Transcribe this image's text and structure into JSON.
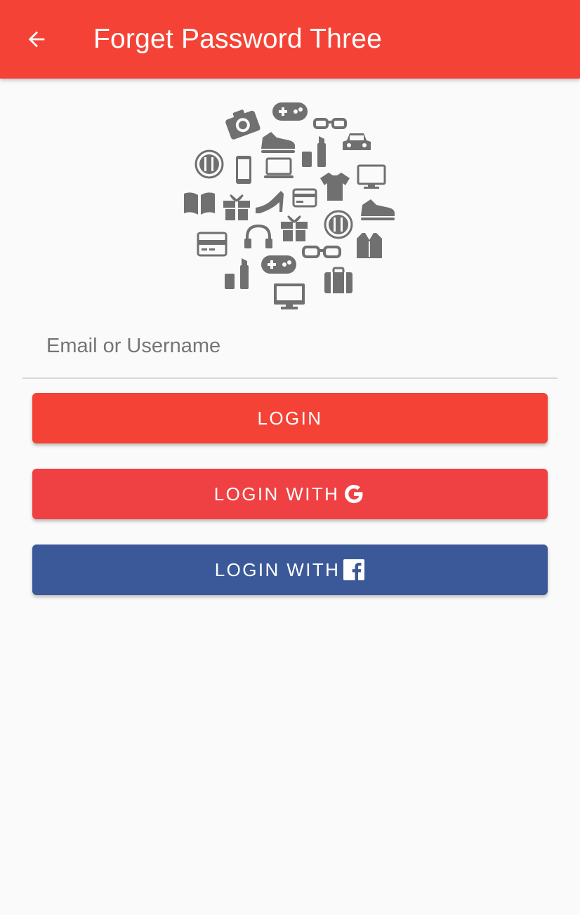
{
  "appbar": {
    "title": "Forget Password Three",
    "back_icon": "arrow-back-icon",
    "color": "#f44336"
  },
  "logo": {
    "icon": "shopping-icons-cluster-icon",
    "icon_color": "#707070"
  },
  "form": {
    "email_placeholder": "Email or Username",
    "email_value": ""
  },
  "buttons": {
    "login_label": "LOGIN",
    "google_label": "LOGIN WITH",
    "google_icon": "google-g-icon",
    "facebook_label": "LOGIN WITH",
    "facebook_icon": "facebook-f-icon"
  },
  "colors": {
    "primary": "#f44336",
    "google": "#ef4143",
    "facebook": "#3b5998",
    "background": "#fafafa"
  }
}
